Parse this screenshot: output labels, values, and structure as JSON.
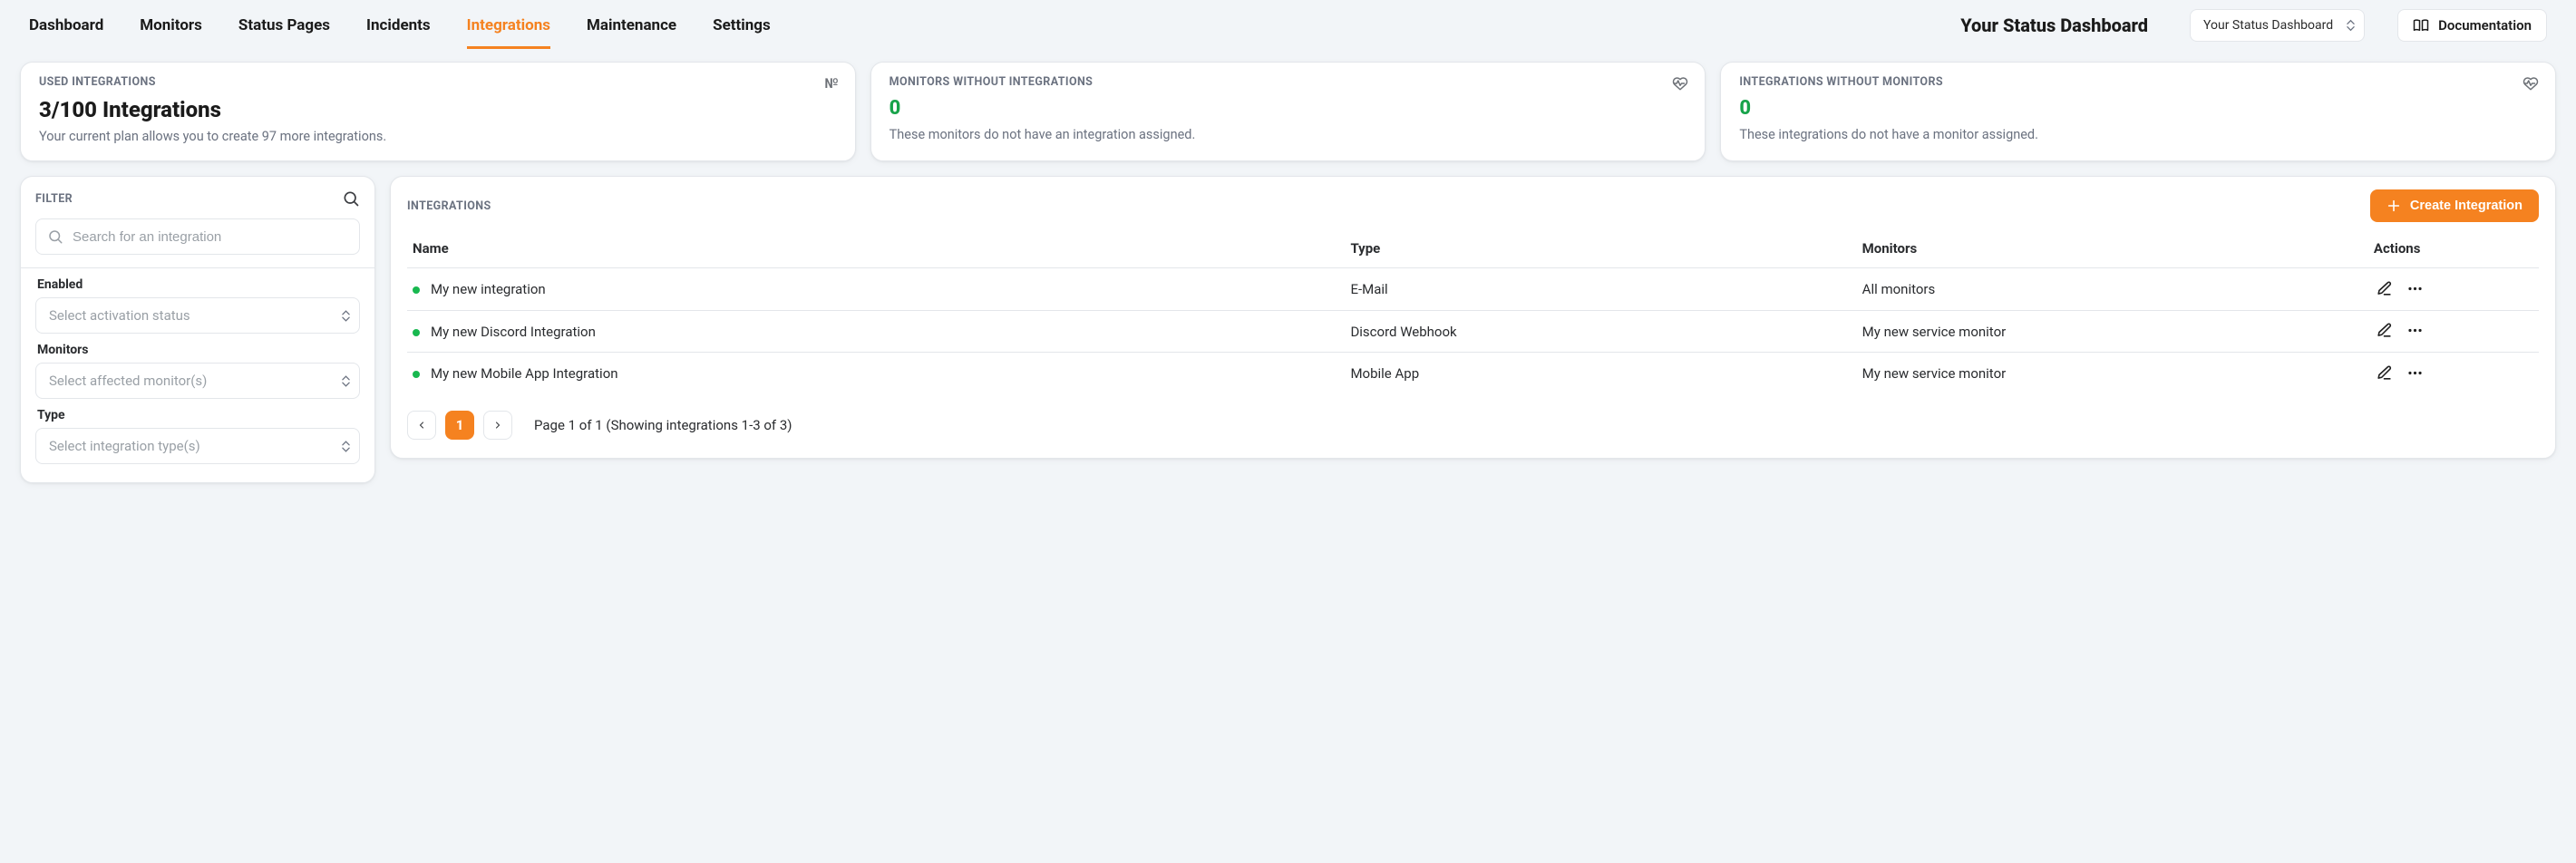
{
  "nav": {
    "items": [
      {
        "label": "Dashboard"
      },
      {
        "label": "Monitors"
      },
      {
        "label": "Status Pages"
      },
      {
        "label": "Incidents"
      },
      {
        "label": "Integrations",
        "active": true
      },
      {
        "label": "Maintenance"
      },
      {
        "label": "Settings"
      }
    ],
    "brand": "Your Status Dashboard",
    "brand_select": "Your Status Dashboard",
    "doc_label": "Documentation"
  },
  "stats": {
    "used": {
      "label": "USED INTEGRATIONS",
      "value": "3/100 Integrations",
      "desc": "Your current plan allows you to create 97 more integrations.",
      "icon_text": "№"
    },
    "without_integrations": {
      "label": "MONITORS WITHOUT INTEGRATIONS",
      "value": "0",
      "desc": "These monitors do not have an integration assigned."
    },
    "without_monitors": {
      "label": "INTEGRATIONS WITHOUT MONITORS",
      "value": "0",
      "desc": "These integrations do not have a monitor assigned."
    }
  },
  "filter": {
    "label": "FILTER",
    "search_placeholder": "Search for an integration",
    "enabled_label": "Enabled",
    "enabled_placeholder": "Select activation status",
    "monitors_label": "Monitors",
    "monitors_placeholder": "Select affected monitor(s)",
    "type_label": "Type",
    "type_placeholder": "Select integration type(s)"
  },
  "table": {
    "label": "INTEGRATIONS",
    "create_label": "Create Integration",
    "columns": {
      "name": "Name",
      "type": "Type",
      "monitors": "Monitors",
      "actions": "Actions"
    },
    "rows": [
      {
        "name": "My new integration",
        "type": "E-Mail",
        "monitors": "All monitors",
        "status": "green"
      },
      {
        "name": "My new Discord Integration",
        "type": "Discord Webhook",
        "monitors": "My new service monitor",
        "status": "green"
      },
      {
        "name": "My new Mobile App Integration",
        "type": "Mobile App",
        "monitors": "My new service monitor",
        "status": "green"
      }
    ],
    "pager": {
      "current": "1",
      "summary": "Page 1 of 1 (Showing integrations 1-3 of 3)"
    }
  }
}
